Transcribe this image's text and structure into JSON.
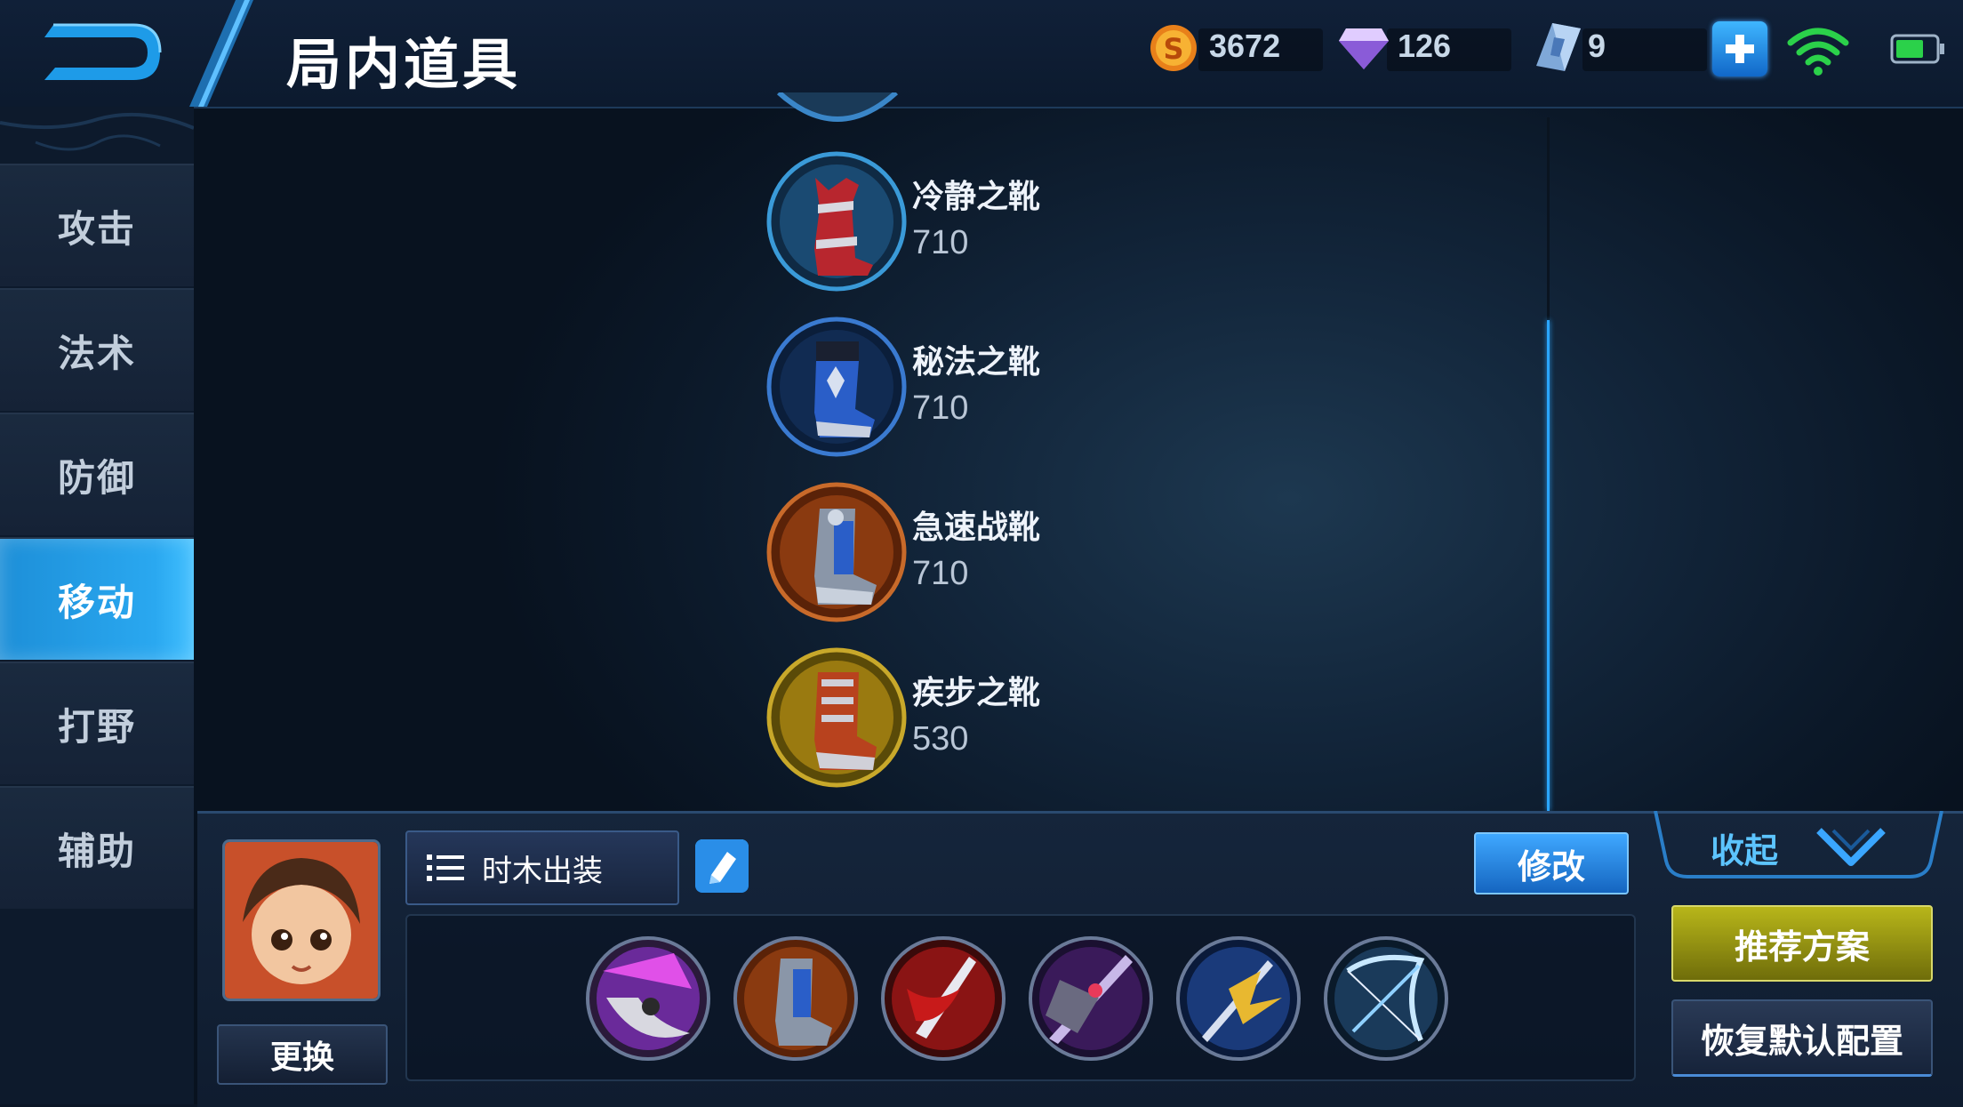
{
  "header": {
    "title": "局内道具",
    "gold": "3672",
    "diamonds": "126",
    "vouchers": "9",
    "plus_icon": "plus-icon",
    "accent": "#2aa6ff"
  },
  "sidebar": {
    "tabs": [
      {
        "label": "攻击"
      },
      {
        "label": "法术"
      },
      {
        "label": "防御"
      },
      {
        "label": "移动"
      },
      {
        "label": "打野"
      },
      {
        "label": "辅助"
      }
    ],
    "active_index": 3,
    "active_color": "#2aa6ff"
  },
  "items": [
    {
      "name": "冷静之靴",
      "price": "710",
      "icon": "cool-boots-icon"
    },
    {
      "name": "秘法之靴",
      "price": "710",
      "icon": "arcane-boots-icon"
    },
    {
      "name": "急速战靴",
      "price": "710",
      "icon": "swift-boots-icon"
    },
    {
      "name": "疾步之靴",
      "price": "530",
      "icon": "quickstep-boots-icon"
    }
  ],
  "bottom": {
    "build_name": "时木出装",
    "modify_label": "修改",
    "swap_label": "更换",
    "collapse_label": "收起",
    "recommend_label": "推荐方案",
    "reset_label": "恢复默认配置",
    "equipment": [
      "purple-axe-icon",
      "swift-boots-icon",
      "red-blade-icon",
      "purple-claw-icon",
      "golden-trident-icon",
      "ice-bow-icon"
    ]
  }
}
